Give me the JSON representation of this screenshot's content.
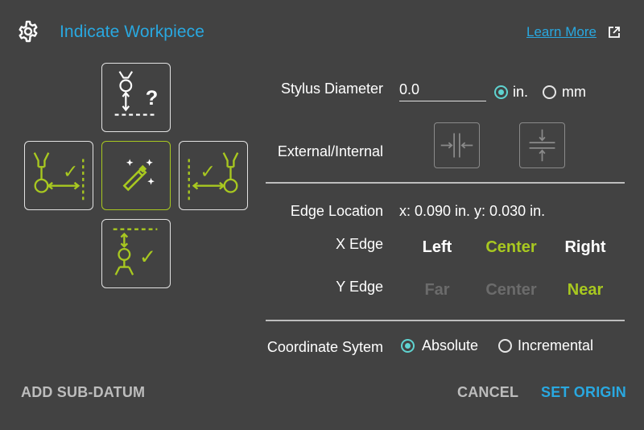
{
  "header": {
    "title": "Indicate Workpiece",
    "learn_more": "Learn More",
    "icons": {
      "settings": "gear-icon",
      "external_link": "external-link-icon"
    }
  },
  "tiles": {
    "top": {
      "icon": "probe-unknown-edge-icon",
      "glyph": "?"
    },
    "left": {
      "icon": "probe-left-edge-icon",
      "glyph": "✓"
    },
    "center": {
      "icon": "magic-wand-icon",
      "selected": true
    },
    "right": {
      "icon": "probe-right-edge-icon",
      "glyph": "✓"
    },
    "bottom": {
      "icon": "probe-bottom-edge-icon",
      "glyph": "✓"
    }
  },
  "form": {
    "stylus_diameter": {
      "label": "Stylus Diameter",
      "value": "0.0",
      "units": [
        {
          "label": "in.",
          "checked": true
        },
        {
          "label": "mm",
          "checked": false
        }
      ]
    },
    "external_internal": {
      "label": "External/Internal",
      "buttons": [
        "external-edge-icon",
        "internal-edge-icon"
      ]
    },
    "edge_location": {
      "label": "Edge Location",
      "value": "x: 0.090 in. y: 0.030 in."
    },
    "x_edge": {
      "label": "X Edge",
      "options": [
        {
          "label": "Left",
          "state": "enabled"
        },
        {
          "label": "Center",
          "state": "selected"
        },
        {
          "label": "Right",
          "state": "enabled"
        }
      ]
    },
    "y_edge": {
      "label": "Y Edge",
      "options": [
        {
          "label": "Far",
          "state": "disabled"
        },
        {
          "label": "Center",
          "state": "disabled"
        },
        {
          "label": "Near",
          "state": "selected"
        }
      ]
    },
    "coordinate_system": {
      "label": "Coordinate Sytem",
      "options": [
        {
          "label": "Absolute",
          "checked": true
        },
        {
          "label": "Incremental",
          "checked": false
        }
      ]
    }
  },
  "footer": {
    "add_sub_datum": "ADD SUB-DATUM",
    "cancel": "CANCEL",
    "set_origin": "SET ORIGIN"
  },
  "colors": {
    "background": "#424242",
    "accent_blue": "#29a8e0",
    "accent_green": "#a8c820",
    "radio_teal": "#5fd3d0",
    "disabled_text": "#6b6b6b"
  }
}
